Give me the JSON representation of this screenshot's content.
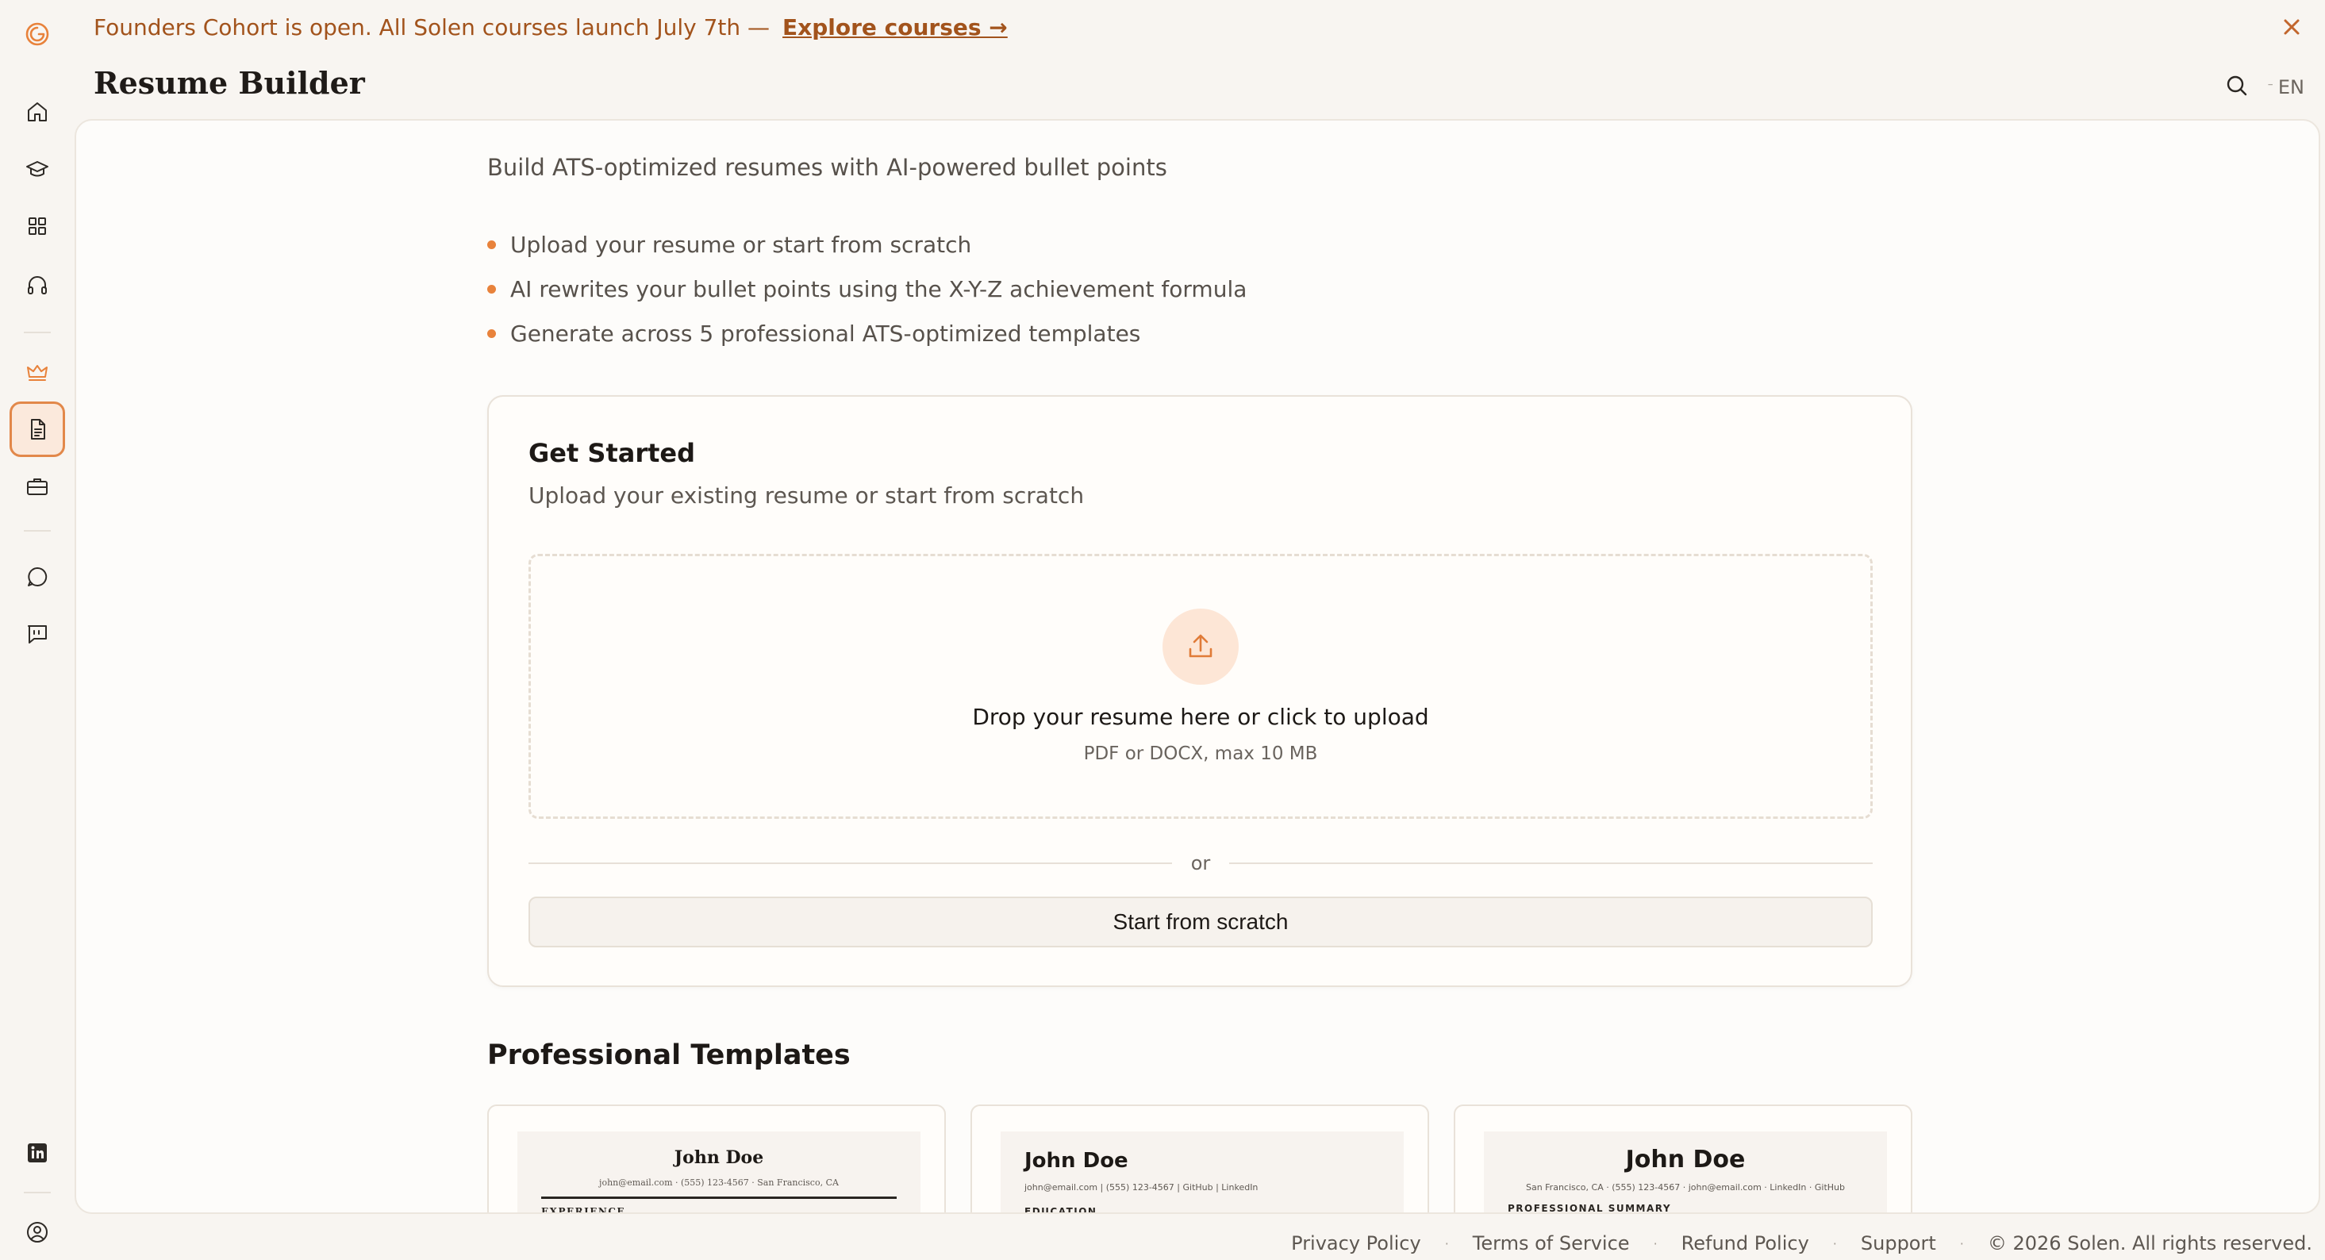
{
  "banner": {
    "message": "Founders Cohort is open. All Solen courses launch July 7th —",
    "link_label": "Explore courses →"
  },
  "header": {
    "title": "Resume Builder",
    "language": "EN"
  },
  "intro": {
    "subtitle": "Build ATS-optimized resumes with AI-powered bullet points",
    "bullets": [
      "Upload your resume or start from scratch",
      "AI rewrites your bullet points using the X-Y-Z achievement formula",
      "Generate across 5 professional ATS-optimized templates"
    ]
  },
  "get_started": {
    "title": "Get Started",
    "subtitle": "Upload your existing resume or start from scratch",
    "dropzone_title": "Drop your resume here or click to upload",
    "dropzone_hint": "PDF or DOCX, max 10 MB",
    "divider": "or",
    "scratch_button": "Start from scratch"
  },
  "templates": {
    "title": "Professional Templates",
    "items": [
      {
        "name": "John Doe",
        "contact": "john@email.com · (555) 123-4567 · San Francisco, CA",
        "section": "EXPERIENCE"
      },
      {
        "name": "John Doe",
        "contact": "john@email.com | (555) 123-4567 | GitHub | LinkedIn",
        "section": "EDUCATION"
      },
      {
        "name": "John Doe",
        "contact": "San Francisco, CA · (555) 123-4567 · john@email.com · LinkedIn · GitHub",
        "section": "PROFESSIONAL SUMMARY"
      }
    ]
  },
  "footer": {
    "links": [
      "Privacy Policy",
      "Terms of Service",
      "Refund Policy",
      "Support"
    ],
    "separator": "·",
    "copyright": "© 2026 Solen. All rights reserved."
  },
  "colors": {
    "accent": "#e8823b",
    "banner_text": "#a2531c",
    "background": "#f8f5f1"
  }
}
